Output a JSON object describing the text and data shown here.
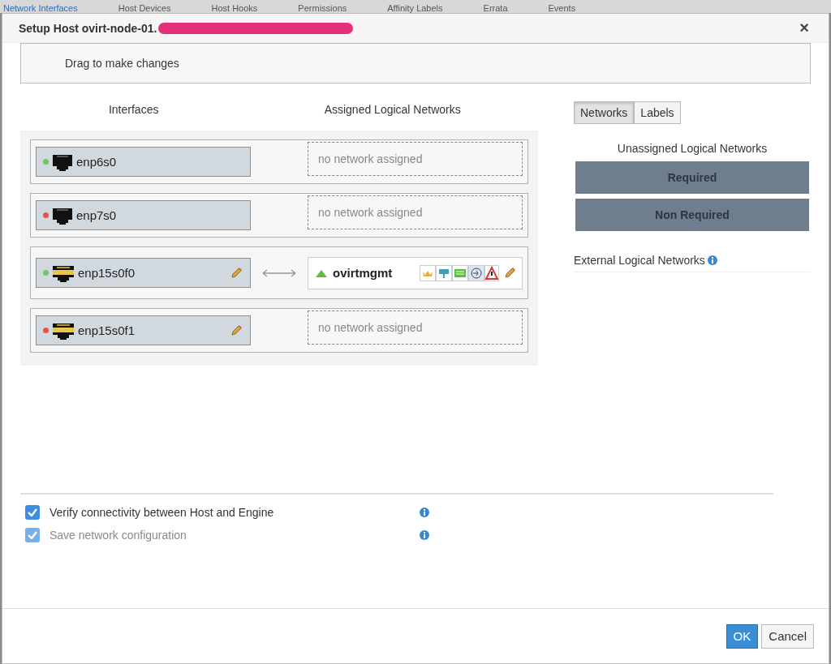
{
  "background_tabs": [
    {
      "label": "Network Interfaces",
      "selected": true
    },
    {
      "label": "Host Devices",
      "selected": false
    },
    {
      "label": "Host Hooks",
      "selected": false
    },
    {
      "label": "Permissions",
      "selected": false
    },
    {
      "label": "Affinity Labels",
      "selected": false
    },
    {
      "label": "Errata",
      "selected": false
    },
    {
      "label": "Events",
      "selected": false
    }
  ],
  "dialog": {
    "title": "Setup Host ovirt-node-01.",
    "redacted": true,
    "close": "×"
  },
  "hint": "Drag to make changes",
  "columns": [
    "Interfaces",
    "Assigned Logical Networks"
  ],
  "interfaces": [
    {
      "name": "enp6s0",
      "up": true,
      "kind": "ethernet",
      "editable": false,
      "assigned": {
        "kind": "empty",
        "text": "no network assigned"
      }
    },
    {
      "name": "enp7s0",
      "up": false,
      "kind": "ethernet",
      "editable": false,
      "assigned": {
        "kind": "empty",
        "text": "no network assigned"
      }
    },
    {
      "name": "enp15s0f0",
      "up": true,
      "kind": "sriov",
      "editable": true,
      "assigned": {
        "kind": "network",
        "name": "ovirtmgmt",
        "up": true,
        "editable": true
      }
    },
    {
      "name": "enp15s0f1",
      "up": false,
      "kind": "sriov",
      "editable": true,
      "assigned": {
        "kind": "empty",
        "text": "no network assigned"
      }
    }
  ],
  "side_tabs": [
    {
      "label": "Networks",
      "selected": true
    },
    {
      "label": "Labels",
      "selected": false
    }
  ],
  "unassigned": {
    "title": "Unassigned Logical Networks",
    "groups": [
      "Required",
      "Non Required"
    ]
  },
  "external": {
    "title": "External Logical Networks"
  },
  "options": [
    {
      "label": "Verify connectivity between Host and Engine",
      "checked": true,
      "disabled": false
    },
    {
      "label": "Save network configuration",
      "checked": true,
      "disabled": true
    }
  ],
  "buttons": [
    {
      "label": "OK",
      "kind": "primary"
    },
    {
      "label": "Cancel",
      "kind": "default"
    }
  ]
}
